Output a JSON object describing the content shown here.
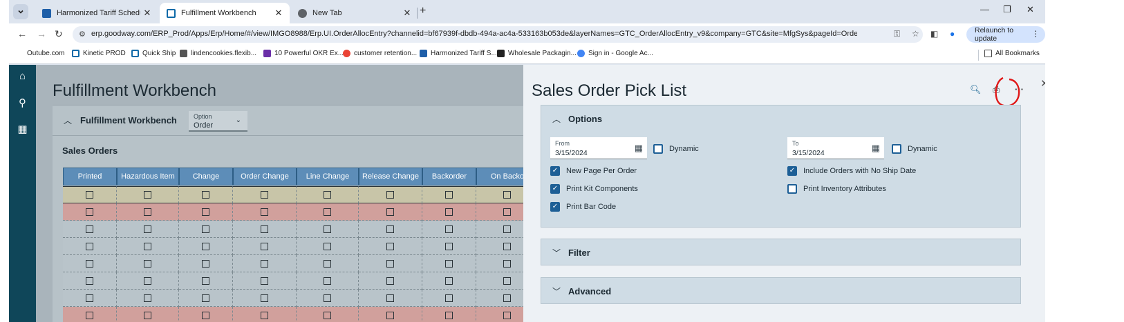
{
  "browser": {
    "tabs": [
      {
        "label": "Harmonized Tariff Schedule",
        "active": false
      },
      {
        "label": "Fulfillment Workbench",
        "active": true
      },
      {
        "label": "New Tab",
        "active": false
      }
    ],
    "new_tab": "+",
    "url": "erp.goodway.com/ERP_Prod/Apps/Erp/Home/#/view/IMGO8988/Erp.UI.OrderAllocEntry?channelid=bf67939f-dbdb-494a-ac4a-533163b053de&layerNames=GTC_OrderAllocEntry_v9&company=GTC&site=MfgSys&pageId=OrderAllocF...",
    "relaunch_label": "Relaunch to update",
    "bookmarks": [
      "Outube.com",
      "Kinetic PROD",
      "Quick Ship",
      "lindencookies.flexib...",
      "10 Powerful OKR Ex...",
      "customer retention...",
      "Harmonized Tariff S...",
      "Wholesale Packagin...",
      "Sign in - Google Ac..."
    ],
    "all_bookmarks": "All Bookmarks"
  },
  "workbench": {
    "title": "Fulfillment Workbench",
    "panel_title": "Fulfillment Workbench",
    "option": {
      "label": "Option",
      "value": "Order"
    },
    "sales_orders_title": "Sales Orders",
    "columns": [
      "Printed",
      "Hazardous Item",
      "Change",
      "Order Change",
      "Line Change",
      "Release Change",
      "Backorder",
      "On Backo"
    ],
    "row_states": [
      "selected",
      "red",
      "normal",
      "normal",
      "normal",
      "normal",
      "normal",
      "red"
    ]
  },
  "drawer": {
    "title": "Sales Order Pick List",
    "options_section": "Options",
    "from": {
      "label": "From",
      "value": "3/15/2024"
    },
    "to": {
      "label": "To",
      "value": "3/15/2024"
    },
    "dynamic_label": "Dynamic",
    "checkboxes": {
      "new_page_per_order": {
        "label": "New Page Per Order",
        "checked": true
      },
      "print_kit_components": {
        "label": "Print Kit Components",
        "checked": true
      },
      "print_bar_code": {
        "label": "Print Bar Code",
        "checked": true
      },
      "include_no_ship_date": {
        "label": "Include Orders with No Ship Date",
        "checked": true
      },
      "print_inventory_attributes": {
        "label": "Print Inventory Attributes",
        "checked": false
      },
      "dynamic_from": {
        "checked": false
      },
      "dynamic_to": {
        "checked": false
      }
    },
    "filter_section": "Filter",
    "advanced_section": "Advanced"
  },
  "colors": {
    "leftnav": "#0f4659",
    "grid_header": "#5d8db8",
    "row_selected": "#c8c5a8",
    "row_red": "#d1a09c",
    "checkbox_accent": "#1d5f96",
    "annotation": "#e01717"
  }
}
